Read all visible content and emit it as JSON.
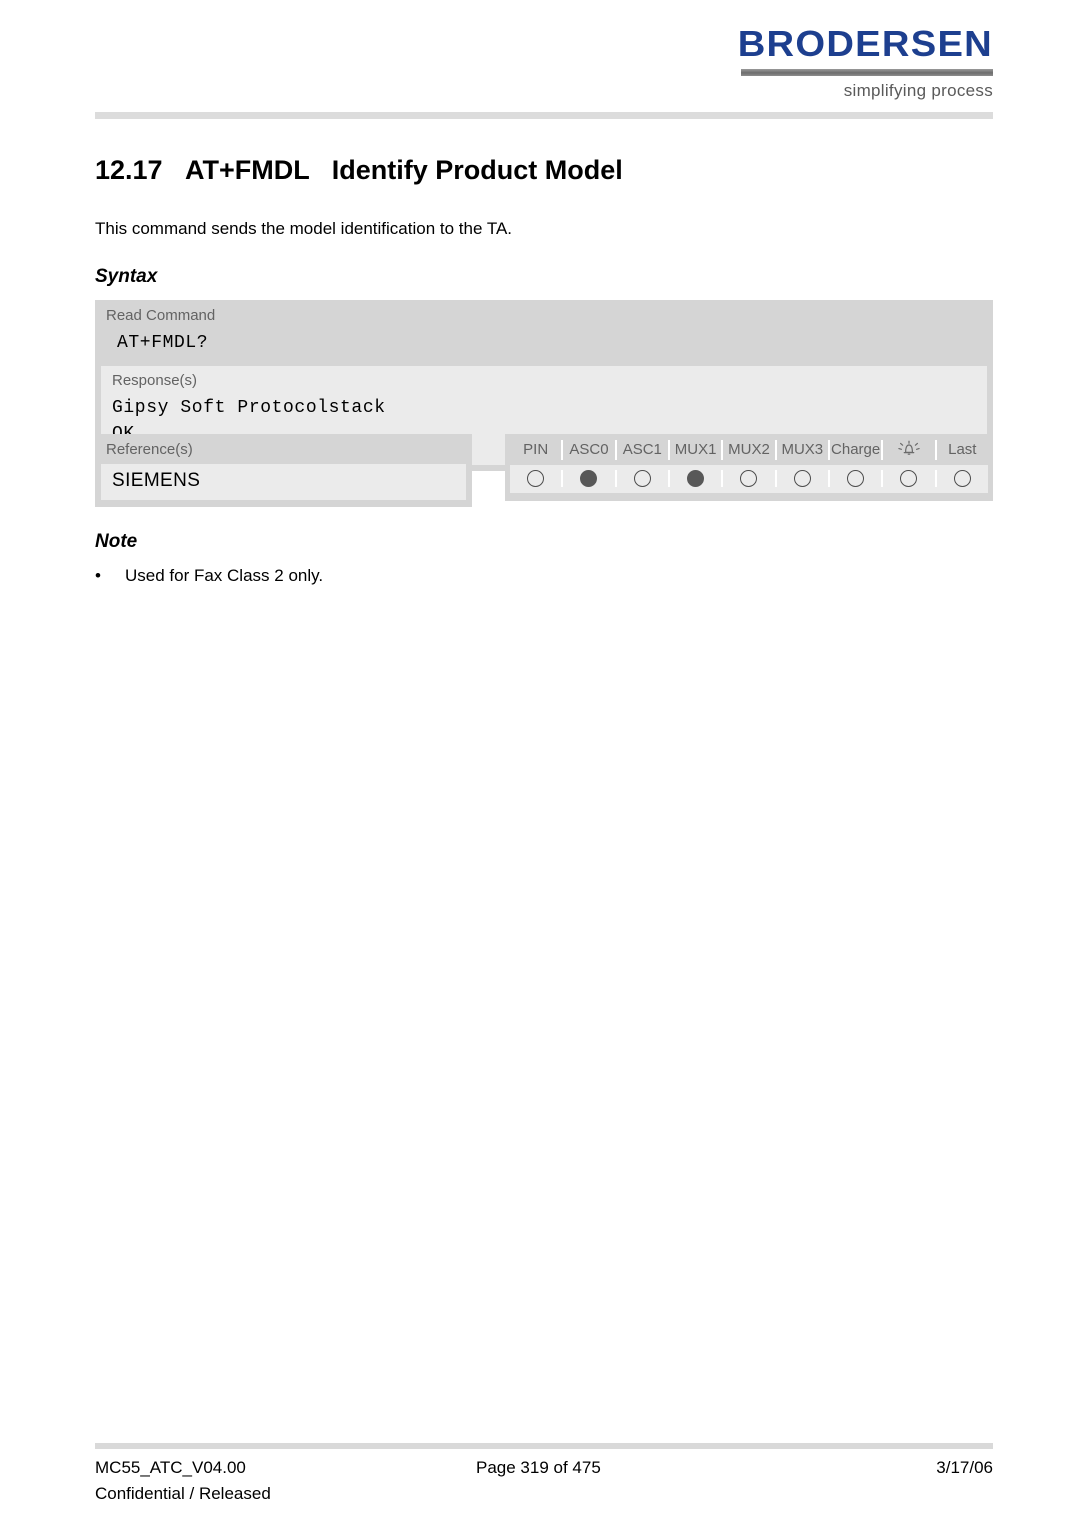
{
  "brand": {
    "wordmark": "BRODERSEN",
    "tagline": "simplifying process"
  },
  "heading": {
    "number": "12.17",
    "command": "AT+FMDL",
    "title": "Identify Product Model"
  },
  "intro": "This command sends the model identification to the TA.",
  "syntax": {
    "label": "Syntax",
    "read_command_label": "Read Command",
    "read_command_value": "AT+FMDL?",
    "responses_label": "Response(s)",
    "response_lines": [
      "Gipsy Soft Protocolstack",
      "OK"
    ]
  },
  "references": {
    "label": "Reference(s)",
    "value": "SIEMENS"
  },
  "feature_table": {
    "columns": [
      {
        "label": "PIN",
        "icon": null,
        "state": "empty"
      },
      {
        "label": "ASC0",
        "icon": null,
        "state": "filled"
      },
      {
        "label": "ASC1",
        "icon": null,
        "state": "empty"
      },
      {
        "label": "MUX1",
        "icon": null,
        "state": "filled"
      },
      {
        "label": "MUX2",
        "icon": null,
        "state": "empty"
      },
      {
        "label": "MUX3",
        "icon": null,
        "state": "empty"
      },
      {
        "label": "Charge",
        "icon": null,
        "state": "empty"
      },
      {
        "label": "",
        "icon": "alarm-bell-icon",
        "state": "empty"
      },
      {
        "label": "Last",
        "icon": null,
        "state": "empty"
      }
    ]
  },
  "note": {
    "label": "Note",
    "bullet": "•",
    "items": [
      "Used for Fax Class 2 only."
    ]
  },
  "footer": {
    "document_id": "MC55_ATC_V04.00",
    "classification": "Confidential / Released",
    "page": "Page 319 of 475",
    "date": "3/17/06"
  },
  "colors": {
    "brand_blue": "#1d3f8f",
    "panel_dark": "#d5d5d5",
    "panel_light": "#ebebeb",
    "rule_gray": "#dcdcdc",
    "label_gray": "#636363"
  }
}
